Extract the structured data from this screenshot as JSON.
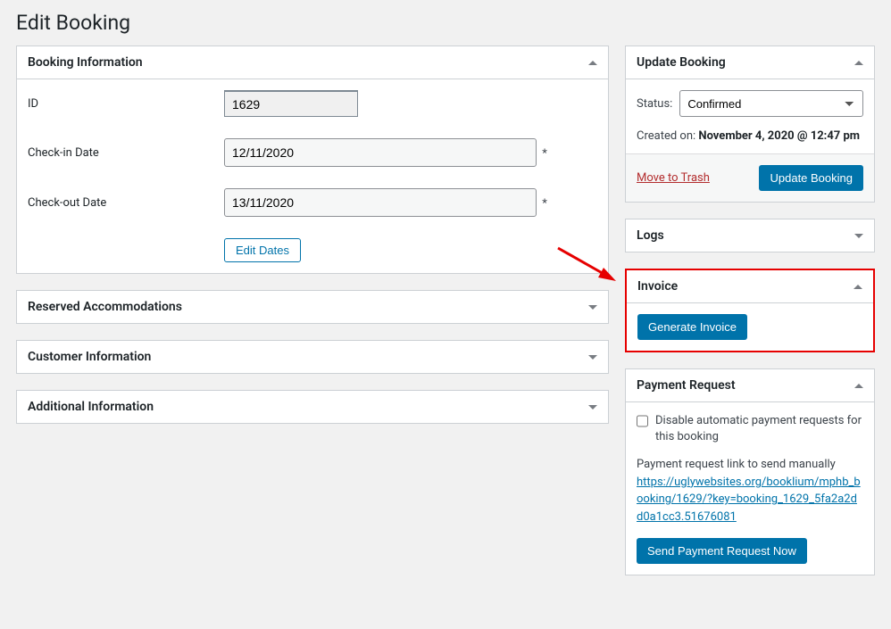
{
  "page": {
    "title": "Edit Booking"
  },
  "booking_info": {
    "panel_title": "Booking Information",
    "id_label": "ID",
    "id_value": "1629",
    "checkin_label": "Check-in Date",
    "checkin_value": "12/11/2020",
    "checkout_label": "Check-out Date",
    "checkout_value": "13/11/2020",
    "edit_dates_label": "Edit Dates"
  },
  "panels": {
    "reserved": "Reserved Accommodations",
    "customer": "Customer Information",
    "additional": "Additional Information"
  },
  "update_booking": {
    "panel_title": "Update Booking",
    "status_label": "Status:",
    "status_value": "Confirmed",
    "created_label": "Created on:",
    "created_value": "November 4, 2020 @ 12:47 pm",
    "trash_label": "Move to Trash",
    "button_label": "Update Booking"
  },
  "logs": {
    "panel_title": "Logs"
  },
  "invoice": {
    "panel_title": "Invoice",
    "button_label": "Generate Invoice"
  },
  "payment_request": {
    "panel_title": "Payment Request",
    "disable_label": "Disable automatic payment requests for this booking",
    "link_intro": "Payment request link to send manually",
    "link_text": "https://uglywebsites.org/booklium/mphb_booking/1629/?key=booking_1629_5fa2a2dd0a1cc3.51676081",
    "button_label": "Send Payment Request Now"
  }
}
